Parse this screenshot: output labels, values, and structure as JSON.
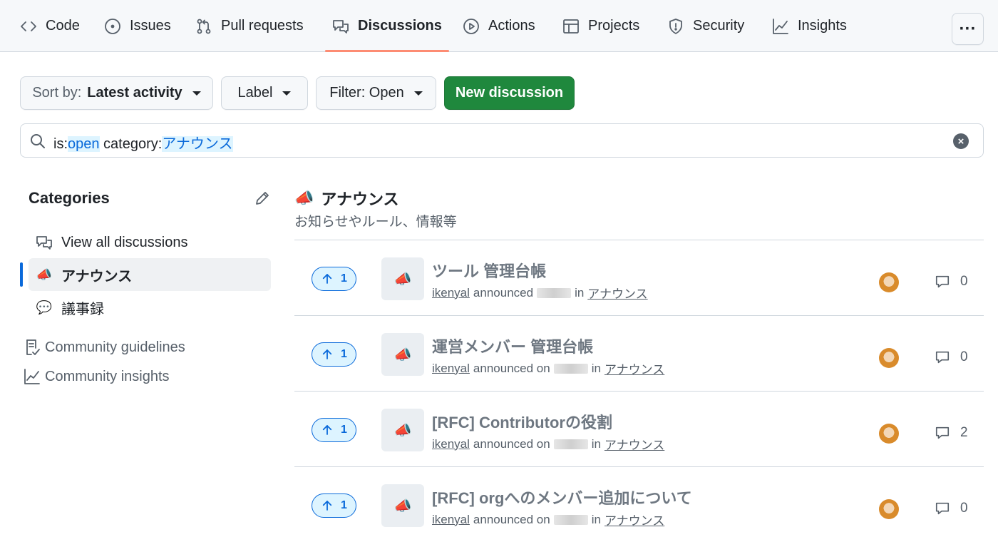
{
  "nav": {
    "tabs": [
      {
        "label": "Code",
        "icon": "code-icon"
      },
      {
        "label": "Issues",
        "icon": "issue-circle-icon"
      },
      {
        "label": "Pull requests",
        "icon": "pull-request-icon"
      },
      {
        "label": "Discussions",
        "icon": "discussions-icon",
        "active": true
      },
      {
        "label": "Actions",
        "icon": "play-icon"
      },
      {
        "label": "Projects",
        "icon": "table-icon"
      },
      {
        "label": "Security",
        "icon": "shield-icon"
      },
      {
        "label": "Insights",
        "icon": "graph-icon"
      }
    ],
    "more_label": "···"
  },
  "toolbar": {
    "sort_prefix": "Sort by:",
    "sort_value": "Latest activity",
    "label_button": "Label",
    "filter_button": "Filter: Open",
    "new_button": "New discussion"
  },
  "search": {
    "q1": "is:",
    "q2": "open",
    "q3": " category:",
    "q4": "アナウンス"
  },
  "sidebar": {
    "title": "Categories",
    "items": [
      {
        "label": "View all discussions",
        "icon": "discussions-icon"
      },
      {
        "label": "アナウンス",
        "emoji": "📣",
        "active": true
      },
      {
        "label": "議事録",
        "emoji": "💬"
      }
    ],
    "links": [
      {
        "label": "Community guidelines",
        "icon": "guidelines-icon"
      },
      {
        "label": "Community insights",
        "icon": "graph-icon"
      }
    ]
  },
  "category": {
    "emoji": "📣",
    "name": "アナウンス",
    "description": "お知らせやルール、情報等"
  },
  "discussions": [
    {
      "votes": "1",
      "emoji": "📣",
      "title": "ツール 管理台帳",
      "author": "ikenyal",
      "verb": "announced",
      "prep": "in",
      "category": "アナウンス",
      "comments": "0"
    },
    {
      "votes": "1",
      "emoji": "📣",
      "title": "運営メンバー 管理台帳",
      "author": "ikenyal",
      "verb": "announced on",
      "prep": "in",
      "category": "アナウンス",
      "comments": "0"
    },
    {
      "votes": "1",
      "emoji": "📣",
      "title": "[RFC] Contributorの役割",
      "author": "ikenyal",
      "verb": "announced on",
      "prep": "in",
      "category": "アナウンス",
      "comments": "2"
    },
    {
      "votes": "1",
      "emoji": "📣",
      "title": "[RFC] orgへのメンバー追加について",
      "author": "ikenyal",
      "verb": "announced on",
      "prep": "in",
      "category": "アナウンス",
      "comments": "0"
    }
  ],
  "colors": {
    "accent": "#0969da",
    "primary_button": "#1f883d",
    "active_tab_underline": "#fd8c73"
  }
}
